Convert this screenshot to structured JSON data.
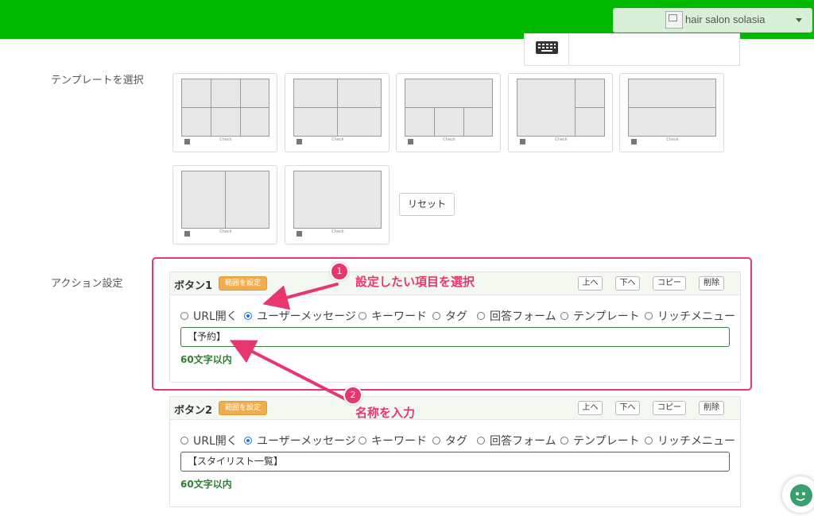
{
  "header": {
    "account_name": "hair salon solasia",
    "colors": {
      "brand": "#00b900",
      "selector_bg": "#d8f0d8"
    }
  },
  "keyboard_icon": "keyboard-icon",
  "template_section": {
    "label": "テンプレートを選択",
    "templates": [
      {
        "layout": "6-grid",
        "check_label": "Check"
      },
      {
        "layout": "4-grid",
        "check_label": "Check"
      },
      {
        "layout": "1-top-3-bottom",
        "check_label": "Check"
      },
      {
        "layout": "1-left-2-right",
        "check_label": "Check"
      },
      {
        "layout": "2-rows",
        "check_label": "Check"
      },
      {
        "layout": "2-columns",
        "check_label": "Check"
      },
      {
        "layout": "single",
        "check_label": "Check"
      }
    ],
    "reset_label": "リセット"
  },
  "action_section": {
    "label": "アクション設定",
    "buttons": [
      {
        "title": "ボタン1",
        "range_label": "範囲を設定",
        "up_label": "上へ",
        "down_label": "下へ",
        "copy_label": "コピー",
        "delete_label": "削除",
        "options": [
          "URL開く",
          "ユーザーメッセージ",
          "キーワード",
          "タグ",
          "回答フォーム",
          "テンプレート",
          "リッチメニュー"
        ],
        "selected_option": "ユーザーメッセージ",
        "text_value": "【予約】",
        "limit_note": "60文字以内"
      },
      {
        "title": "ボタン2",
        "range_label": "範囲を設定",
        "up_label": "上へ",
        "down_label": "下へ",
        "copy_label": "コピー",
        "delete_label": "削除",
        "options": [
          "URL開く",
          "ユーザーメッセージ",
          "キーワード",
          "タグ",
          "回答フォーム",
          "テンプレート",
          "リッチメニュー"
        ],
        "selected_option": "ユーザーメッセージ",
        "text_value": "【スタイリスト一覧】",
        "limit_note": "60文字以内"
      }
    ]
  },
  "annotations": {
    "color": "#e8366e",
    "steps": [
      {
        "number": "1",
        "text": "設定したい項目を選択"
      },
      {
        "number": "2",
        "text": "名称を入力"
      }
    ]
  }
}
